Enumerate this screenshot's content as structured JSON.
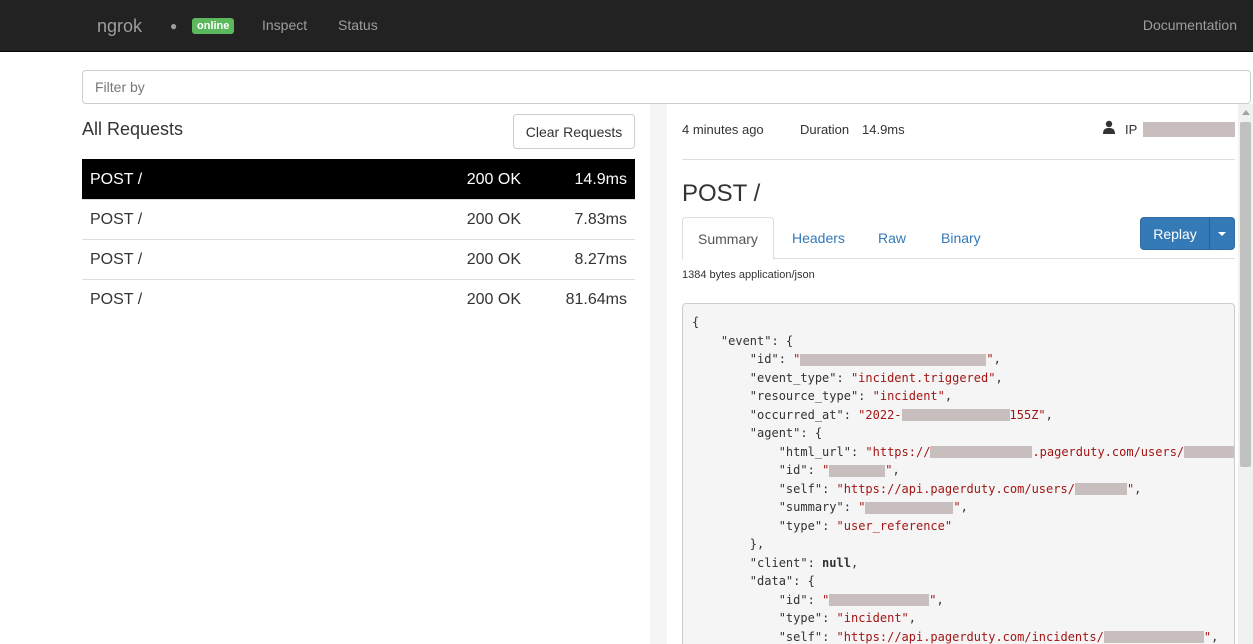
{
  "navbar": {
    "brand": "ngrok",
    "dot": "●",
    "status_badge": "online",
    "links": {
      "inspect": "Inspect",
      "status": "Status",
      "docs": "Documentation"
    }
  },
  "filter": {
    "placeholder": "Filter by",
    "value": ""
  },
  "requests": {
    "title": "All Requests",
    "clear_label": "Clear Requests",
    "rows": [
      {
        "method": "POST /",
        "status": "200 OK",
        "duration": "14.9ms"
      },
      {
        "method": "POST /",
        "status": "200 OK",
        "duration": "7.83ms"
      },
      {
        "method": "POST /",
        "status": "200 OK",
        "duration": "8.27ms"
      },
      {
        "method": "POST /",
        "status": "200 OK",
        "duration": "81.64ms"
      }
    ]
  },
  "detail": {
    "time_ago": "4 minutes ago",
    "duration_label": "Duration",
    "duration": "14.9ms",
    "ip_label": "IP",
    "title": "POST /",
    "tabs": {
      "summary": "Summary",
      "headers": "Headers",
      "raw": "Raw",
      "binary": "Binary"
    },
    "replay_label": "Replay",
    "body_meta": "1384 bytes application/json",
    "json": {
      "open": "{",
      "event_key": "\"event\"",
      "id_key": "\"id\"",
      "event_type_key": "\"event_type\"",
      "event_type_val": "\"incident.triggered\"",
      "resource_type_key": "\"resource_type\"",
      "resource_type_val": "\"incident\"",
      "occurred_at_key": "\"occurred_at\"",
      "occurred_at_prefix": "\"2022-",
      "occurred_at_suffix": "155Z\"",
      "agent_key": "\"agent\"",
      "html_url_key": "\"html_url\"",
      "html_url_prefix": "\"https://",
      "html_url_mid": ".pagerduty.com/users/",
      "self_key": "\"self\"",
      "agent_self_prefix": "\"https://api.pagerduty.com/users/",
      "summary_key": "\"summary\"",
      "type_key": "\"type\"",
      "type_user_ref": "\"user_reference\"",
      "client_key": "\"client\"",
      "null_val": "null",
      "data_key": "\"data\"",
      "type_incident": "\"incident\"",
      "data_self_prefix": "\"https://api.pagerduty.com/incidents/"
    }
  }
}
